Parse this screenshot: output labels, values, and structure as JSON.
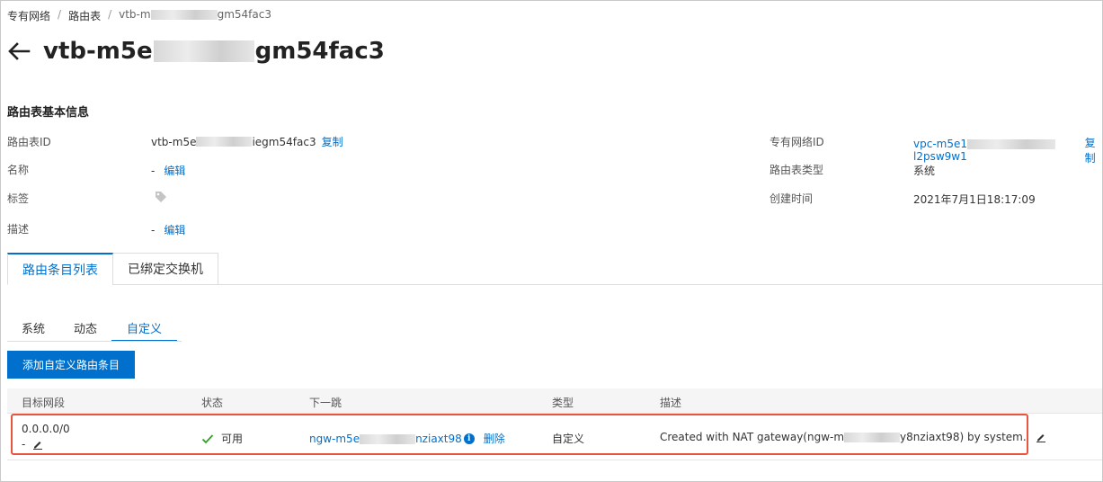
{
  "breadcrumb": {
    "item1": "专有网络",
    "sep": "/",
    "item2": "路由表",
    "current_prefix": "vtb-m",
    "current_suffix": "gm54fac3"
  },
  "title": {
    "prefix": "vtb-m5e",
    "suffix": "gm54fac3"
  },
  "section_title": "路由表基本信息",
  "info": {
    "route_table_id_label": "路由表ID",
    "route_table_id_prefix": "vtb-m5e",
    "route_table_id_suffix": "iegm54fac3",
    "copy_label": "复制",
    "name_label": "名称",
    "name_value": "-",
    "edit_label": "编辑",
    "tag_label": "标签",
    "desc_label": "描述",
    "desc_value": "-",
    "vpc_id_label": "专有网络ID",
    "vpc_id_prefix": "vpc-m5e1",
    "vpc_id_suffix": "l2psw9w1",
    "type_label": "路由表类型",
    "type_value": "系统",
    "created_label": "创建时间",
    "created_value": "2021年7月1日18:17:09"
  },
  "main_tabs": [
    "路由条目列表",
    "已绑定交换机"
  ],
  "sub_tabs": [
    "系统",
    "动态",
    "自定义"
  ],
  "add_button": "添加自定义路由条目",
  "table": {
    "headers": [
      "目标网段",
      "状态",
      "下一跳",
      "类型",
      "描述"
    ],
    "row": {
      "cidr": "0.0.0.0/0",
      "cidr_name": "-",
      "status": "可用",
      "next_hop_prefix": "ngw-m5e",
      "next_hop_suffix": "nziaxt98",
      "delete_label": "删除",
      "type": "自定义",
      "desc_prefix": "Created with NAT gateway(ngw-m",
      "desc_suffix": "y8nziaxt98) by system."
    }
  },
  "colors": {
    "accent": "#0070cc",
    "highlight": "#e8553e",
    "success": "#2ea121"
  }
}
